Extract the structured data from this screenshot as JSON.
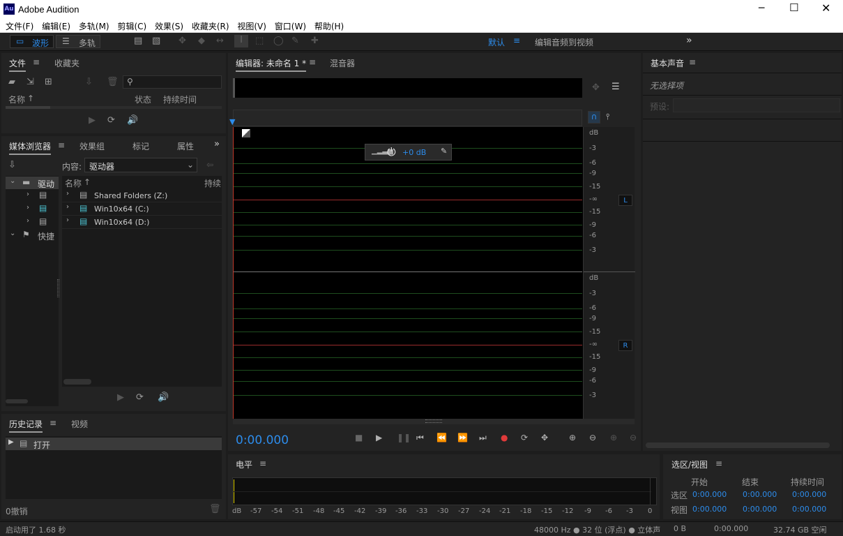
{
  "window": {
    "title": "Adobe Audition",
    "logo": "Au"
  },
  "menu": [
    "文件(F)",
    "编辑(E)",
    "多轨(M)",
    "剪辑(C)",
    "效果(S)",
    "收藏夹(R)",
    "视图(V)",
    "窗口(W)",
    "帮助(H)"
  ],
  "toolbar": {
    "waveform": "波形",
    "multitrack": "多轨",
    "workspace": "默认",
    "workspace2": "编辑音频到视频"
  },
  "files_panel": {
    "tab_files": "文件",
    "tab_favorites": "收藏夹",
    "col_name": "名称",
    "col_status": "状态",
    "col_duration": "持续时间"
  },
  "media_browser": {
    "tabs": [
      "媒体浏览器",
      "效果组",
      "标记",
      "属性"
    ],
    "content_label": "内容:",
    "content_value": "驱动器",
    "tree": [
      "驱动",
      "快捷"
    ],
    "col_name": "名称",
    "col_duration": "持续",
    "drives": [
      "Shared Folders (Z:)",
      "Win10x64 (C:)",
      "Win10x64 (D:)"
    ]
  },
  "history": {
    "tab_history": "历史记录",
    "tab_video": "视频",
    "item": "打开",
    "undo": "0撤销"
  },
  "editor": {
    "tab_editor": "编辑器: 未命名 1 *",
    "tab_mixer": "混音器",
    "hud_gain": "+0 dB",
    "db_unit": "dB",
    "scale_top": [
      "-3",
      "-6",
      "-9",
      "-15",
      "-∞",
      "-15",
      "-9",
      "-6",
      "-3"
    ],
    "channel_L": "L",
    "channel_R": "R",
    "time": "0:00.000"
  },
  "essential_sound": {
    "title": "基本声音",
    "no_selection": "无选择项",
    "preset": "预设:"
  },
  "levels": {
    "title": "电平",
    "ruler": [
      "dB",
      "-57",
      "-54",
      "-51",
      "-48",
      "-45",
      "-42",
      "-39",
      "-36",
      "-33",
      "-30",
      "-27",
      "-24",
      "-21",
      "-18",
      "-15",
      "-12",
      "-9",
      "-6",
      "-3",
      "0"
    ]
  },
  "selection_view": {
    "title": "选区/视图",
    "col_start": "开始",
    "col_end": "结束",
    "col_duration": "持续时间",
    "row_selection": "选区",
    "row_view": "视图",
    "values": [
      "0:00.000",
      "0:00.000",
      "0:00.000",
      "0:00.000",
      "0:00.000",
      "0:00.000"
    ]
  },
  "status": {
    "startup": "启动用了 1.68 秒",
    "format": "48000 Hz ● 32 位 (浮点) ● 立体声",
    "size": "0 B",
    "duration": "0:00.000",
    "free": "32.74 GB 空闲"
  },
  "colors": {
    "accent": "#2d8ceb",
    "record": "#e03a3a",
    "logo_bg": "#00005b",
    "logo_fg": "#9999ff"
  }
}
